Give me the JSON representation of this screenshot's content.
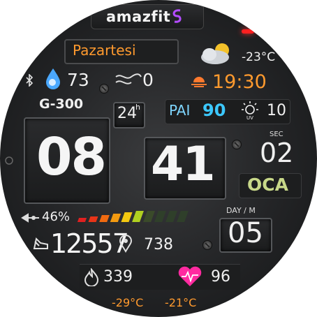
{
  "brand": {
    "name": "amazfit"
  },
  "date": {
    "weekday": "Pazartesi",
    "day": "05",
    "month": "OCA",
    "day_month_label": "DAY / M"
  },
  "time": {
    "hours": "08",
    "minutes": "41",
    "seconds": "02",
    "seconds_label": "SEC",
    "format": "24",
    "format_suffix": "h",
    "model": "G-300"
  },
  "weather": {
    "temperature": "-23°C",
    "condition_icon": "partly-cloudy-icon",
    "sunset_time": "19:30",
    "min_temp": "-29°C",
    "max_temp": "-21°C"
  },
  "stats": {
    "humidity": "73",
    "wind": "0",
    "pai_label": "PAI",
    "pai": "90",
    "uv_label": "UV",
    "uv": "10",
    "battery": "46%",
    "battery_fraction": 0.46,
    "steps": "12557",
    "distance": "738",
    "calories": "339",
    "heart_rate": "96"
  },
  "colors": {
    "accent_orange": "#ff9a2e",
    "pai_blue": "#3cc8ff",
    "heart_pink": "#ff2aa0",
    "month_green": "#c8d889"
  }
}
